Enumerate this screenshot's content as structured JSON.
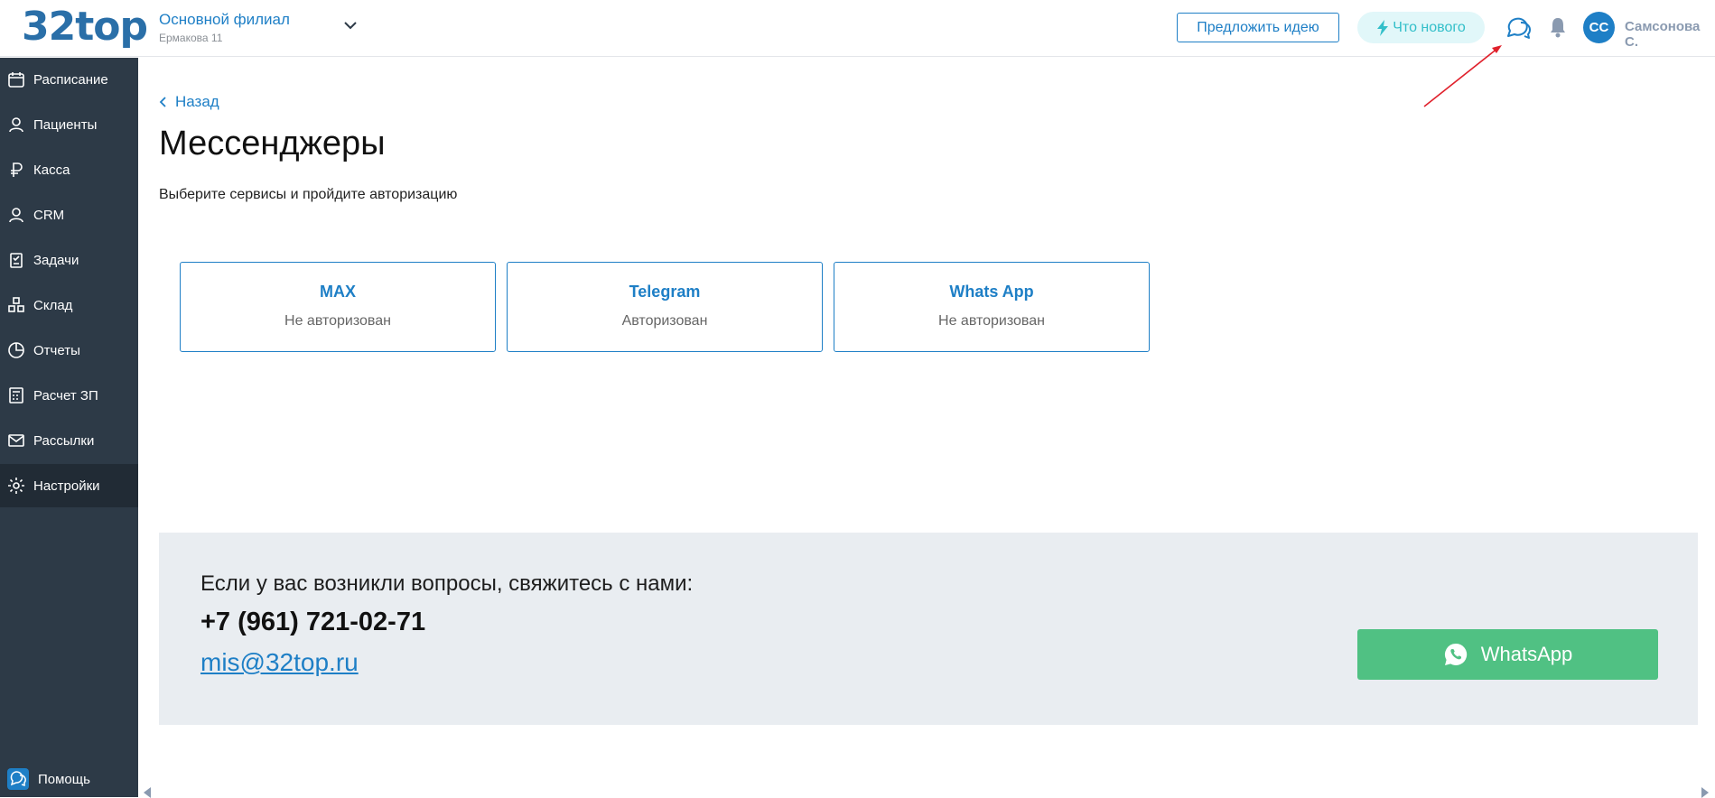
{
  "header": {
    "logo": "32top",
    "branch_name": "Основной филиал",
    "branch_address": "Ермакова 11",
    "suggest_idea_label": "Предложить идею",
    "whats_new_label": "Что нового",
    "avatar_initials": "СС",
    "user_name": "Самсонова С."
  },
  "sidebar": {
    "items": [
      {
        "label": "Расписание",
        "icon": "calendar-icon"
      },
      {
        "label": "Пациенты",
        "icon": "user-icon"
      },
      {
        "label": "Касса",
        "icon": "ruble-icon"
      },
      {
        "label": "CRM",
        "icon": "user-icon"
      },
      {
        "label": "Задачи",
        "icon": "clipboard-icon"
      },
      {
        "label": "Склад",
        "icon": "boxes-icon"
      },
      {
        "label": "Отчеты",
        "icon": "pie-chart-icon"
      },
      {
        "label": "Расчет ЗП",
        "icon": "calculator-icon"
      },
      {
        "label": "Рассылки",
        "icon": "mail-icon"
      },
      {
        "label": "Настройки",
        "icon": "gear-icon"
      }
    ],
    "active_index": 9,
    "help_label": "Помощь"
  },
  "main": {
    "back_label": "Назад",
    "title": "Мессенджеры",
    "subtitle": "Выберите сервисы и пройдите авторизацию",
    "cards": [
      {
        "title": "MAX",
        "status": "Не авторизован"
      },
      {
        "title": "Telegram",
        "status": "Авторизован"
      },
      {
        "title": "Whats App",
        "status": "Не авторизован"
      }
    ]
  },
  "contact": {
    "question": "Если у вас возникли вопросы, свяжитесь с нами:",
    "phone": "+7 (961) 721-02-71",
    "email": "mis@32top.ru",
    "whatsapp_label": "WhatsApp"
  },
  "colors": {
    "accent": "#1e7fc6",
    "sidebar_bg": "#2d3a47",
    "whatsapp_green": "#50c183",
    "whats_new_bg": "#e1f7f9",
    "contact_bg": "#e9edf1",
    "annotation_arrow": "#e0212c"
  }
}
